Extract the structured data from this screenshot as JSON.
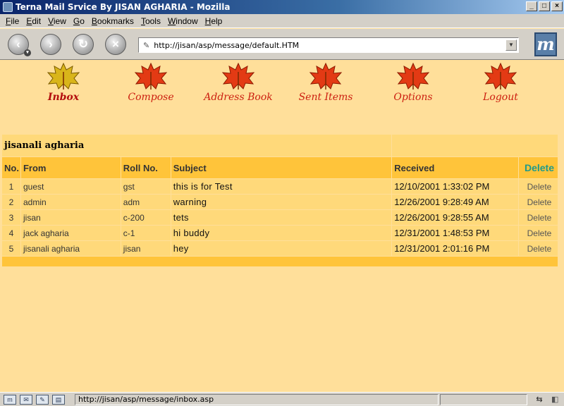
{
  "window": {
    "title": "Terna Mail Srvice By JISAN AGHARIA - Mozilla"
  },
  "menubar": [
    {
      "ul": "F",
      "rest": "ile"
    },
    {
      "ul": "E",
      "rest": "dit"
    },
    {
      "ul": "V",
      "rest": "iew"
    },
    {
      "ul": "G",
      "rest": "o"
    },
    {
      "ul": "B",
      "rest": "ookmarks"
    },
    {
      "ul": "T",
      "rest": "ools"
    },
    {
      "ul": "W",
      "rest": "indow"
    },
    {
      "ul": "H",
      "rest": "elp"
    }
  ],
  "toolbar": {
    "url": "http://jisan/asp/message/default.HTM",
    "icons": [
      "back-icon",
      "forward-icon",
      "reload-icon",
      "stop-icon"
    ]
  },
  "nav": [
    {
      "label": "Inbox",
      "active": true
    },
    {
      "label": "Compose"
    },
    {
      "label": "Address Book"
    },
    {
      "label": "Sent Items"
    },
    {
      "label": "Options"
    },
    {
      "label": "Logout"
    }
  ],
  "mailbox": {
    "user_name": "jisanali agharia",
    "columns": [
      "No.",
      "From",
      "Roll No.",
      "Subject",
      "Received",
      "Delete"
    ],
    "rows": [
      {
        "no": "1",
        "from": "guest",
        "roll": "gst",
        "subject": "this is for Test",
        "received": "12/10/2001 1:33:02 PM",
        "action": "Delete"
      },
      {
        "no": "2",
        "from": "admin",
        "roll": "adm",
        "subject": "warning",
        "received": "12/26/2001 9:28:49 AM",
        "action": "Delete"
      },
      {
        "no": "3",
        "from": "jisan",
        "roll": "c-200",
        "subject": "tets",
        "received": "12/26/2001 9:28:55 AM",
        "action": "Delete"
      },
      {
        "no": "4",
        "from": "jack agharia",
        "roll": "c-1",
        "subject": "hi buddy",
        "received": "12/31/2001 1:48:53 PM",
        "action": "Delete"
      },
      {
        "no": "5",
        "from": "jisanali agharia",
        "roll": "jisan",
        "subject": "hey",
        "received": "12/31/2001 2:01:16 PM",
        "action": "Delete"
      }
    ]
  },
  "statusbar": {
    "text": "http://jisan/asp/message/inbox.asp"
  },
  "colors": {
    "page_bg": "#ffdf9a",
    "row_bg": "#ffd97a",
    "header_bg": "#ffc43a",
    "nav_label": "#cc1f10",
    "delete_header": "#1f9a8a"
  }
}
